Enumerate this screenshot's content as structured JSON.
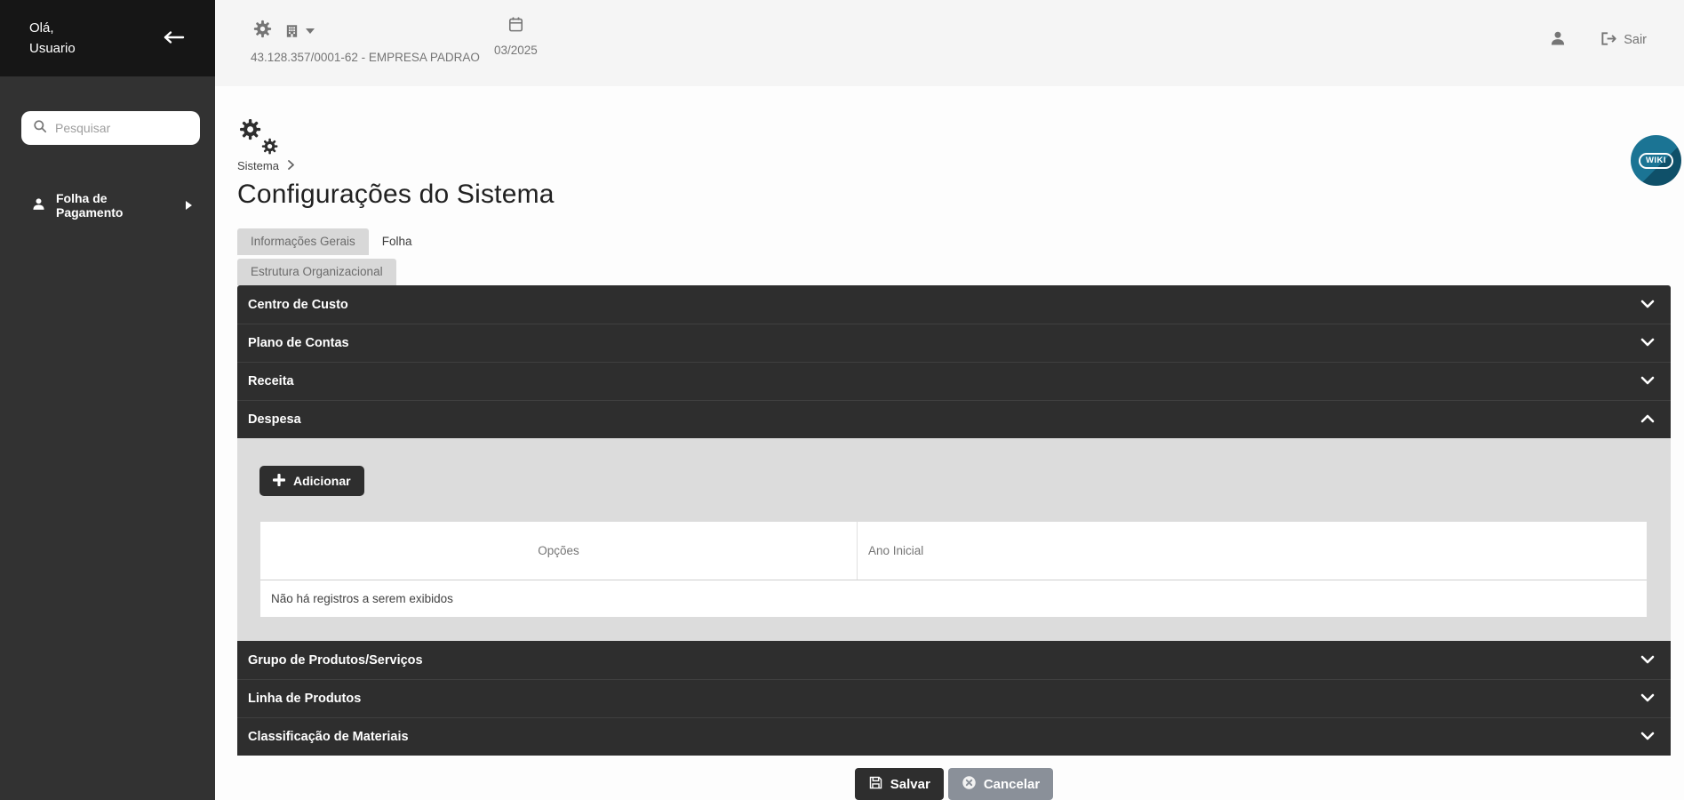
{
  "sidebar": {
    "greeting_line1": "Olá,",
    "greeting_line2": "Usuario",
    "search_placeholder": "Pesquisar",
    "menu": [
      {
        "label": "Folha de Pagamento"
      }
    ]
  },
  "topbar": {
    "company": "43.128.357/0001-62 - EMPRESA PADRAO",
    "period": "03/2025",
    "logout_label": "Sair"
  },
  "page": {
    "breadcrumb": "Sistema",
    "title": "Configurações do Sistema",
    "wiki_label": "WIKI"
  },
  "tabs": {
    "row1": [
      {
        "label": "Informações Gerais",
        "active": true
      },
      {
        "label": "Folha",
        "active": false
      }
    ],
    "row2": [
      {
        "label": "Estrutura Organizacional",
        "active": true
      }
    ]
  },
  "accordion": {
    "sections": [
      {
        "label": "Centro de Custo",
        "expanded": false
      },
      {
        "label": "Plano de Contas",
        "expanded": false
      },
      {
        "label": "Receita",
        "expanded": false
      },
      {
        "label": "Despesa",
        "expanded": true
      },
      {
        "label": "Grupo de Produtos/Serviços",
        "expanded": false
      },
      {
        "label": "Linha de Produtos",
        "expanded": false
      },
      {
        "label": "Classificação de Materiais",
        "expanded": false
      }
    ]
  },
  "despesa_panel": {
    "add_button_label": "Adicionar",
    "table": {
      "columns": [
        "Opções",
        "Ano Inicial"
      ],
      "empty_message": "Não há registros a serem exibidos"
    }
  },
  "footer": {
    "save_label": "Salvar",
    "cancel_label": "Cancelar"
  },
  "icons": {
    "search": "🔍",
    "gear": "⚙",
    "building": "🏢",
    "calendar": "📅",
    "user": "👤",
    "logout": "⎋",
    "plus": "+",
    "save": "💾",
    "cancel": "⊗",
    "chevron_down": "⌄",
    "chevron_up": "⌃",
    "arrow_left": "←"
  },
  "colors": {
    "sidebar_bg": "#323232",
    "sidebar_header_bg": "#161616",
    "topbar_bg": "#f5f5f5",
    "accordion_bg": "#2e2e2e",
    "panel_bg": "#dcdcdc",
    "tab_active_bg": "#d8d8d8",
    "muted_text": "#757575",
    "cancel_btn": "#8a9099",
    "wiki_teal": "#1b7494"
  }
}
